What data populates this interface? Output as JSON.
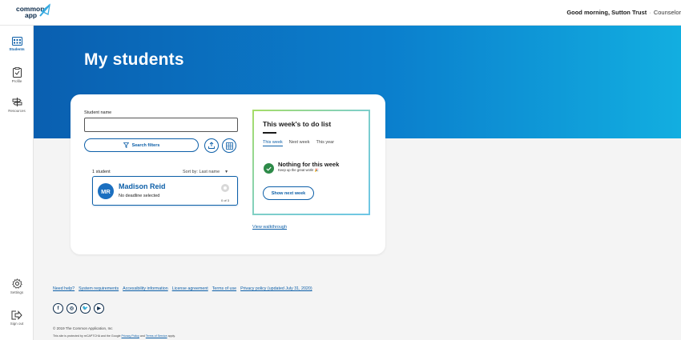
{
  "header": {
    "logo_line1": "common",
    "logo_line2": "app",
    "greeting": "Good morning, Sutton Trust",
    "separator": "·",
    "role": "Counselor"
  },
  "nav": {
    "items": [
      {
        "label": "Students",
        "icon": "students-icon",
        "active": true
      },
      {
        "label": "Profile",
        "icon": "clipboard-icon",
        "active": false
      },
      {
        "label": "Resources",
        "icon": "signpost-icon",
        "active": false
      }
    ],
    "bottom": [
      {
        "label": "Settings",
        "icon": "gear-icon"
      },
      {
        "label": "Sign out",
        "icon": "sign-out-icon"
      }
    ]
  },
  "page": {
    "title": "My students"
  },
  "search": {
    "label": "Student name",
    "value": "",
    "placeholder": "",
    "filters_label": "Search filters"
  },
  "results": {
    "count": "1 student",
    "sort_label": "Sort by: Last name",
    "students": [
      {
        "initials": "MR",
        "name": "Madison Reid",
        "status": "No deadline selected",
        "progress": "0 of 3"
      }
    ]
  },
  "todo": {
    "title": "This week's to do list",
    "tabs": [
      "This week",
      "Next week",
      "This year"
    ],
    "active_tab": "This week",
    "empty_title": "Nothing for this week",
    "empty_sub": "Keep up the great work! 🎉",
    "next_button": "Show next week"
  },
  "walkthrough": "View walkthrough",
  "footer": {
    "links": [
      "Need help?",
      "System requirements",
      "Accessibility information",
      "License agreement",
      "Terms of use",
      "Privacy policy (updated July 31, 2020)"
    ],
    "social": [
      "f",
      "◎",
      "🐦",
      "▶"
    ],
    "copyright": "© 2019 The Common Application, Inc",
    "recaptcha_prefix": "This site is protected by reCAPTCHA and the Google",
    "privacy_policy": "Privacy Policy",
    "and": "and",
    "terms_of_service": "Terms of Service",
    "apply": "apply."
  },
  "colors": {
    "primary": "#0d5fa8",
    "hero_start": "#0a5fb0",
    "hero_end": "#12aee0",
    "success": "#2d8a48"
  }
}
